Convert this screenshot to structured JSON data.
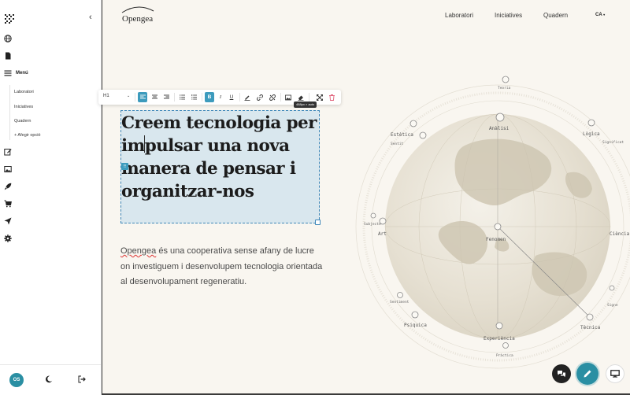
{
  "sidebar": {
    "menu_label": "Menú",
    "sub_items": [
      "Laboratori",
      "Iniciatives",
      "Quadern"
    ],
    "add_option": "+ Afegir opció",
    "user_initials": "OS",
    "icons": [
      "globe-icon",
      "page-icon",
      "menu-icon",
      "edit-icon",
      "image-icon",
      "rocket-icon",
      "cart-icon",
      "send-icon",
      "gear-icon"
    ]
  },
  "site": {
    "logo": "Opengea",
    "nav": [
      "Laboratori",
      "Iniciatives",
      "Quadern"
    ],
    "lang": "CA",
    "hero": {
      "title": "Creem tecnologia per impulsar una nova manera de pensar i organitzar-nos",
      "desc_brand": "Opengea",
      "desc_rest": " és una cooperativa sense afany de lucre on investiguem i desenvolupem tecnologia orientada al desenvolupament regeneratiu."
    }
  },
  "editor": {
    "block_type": "H1",
    "size_tooltip": "488px × auto"
  },
  "globe": {
    "labels": {
      "teoria": "Teoria",
      "analisi": "Anàlisi",
      "estetica": "Estètica",
      "sentit": "Sentit",
      "logica": "Lògica",
      "significat": "Significat",
      "subjecte": "Subjecte",
      "art": "Art",
      "fenomen": "Fenomen",
      "ciencia": "Ciència",
      "sentiment": "Sentiment",
      "psiquica": "Psiquica",
      "experiencia": "Experiència",
      "practica": "Pràctica",
      "tecnica": "Tècnica",
      "signe": "Signe"
    }
  },
  "colors": {
    "accent": "#3d9bbd",
    "fab": "#2a8fa3",
    "site_bg": "#f9f6f0",
    "selection": "#d9e7ee"
  }
}
